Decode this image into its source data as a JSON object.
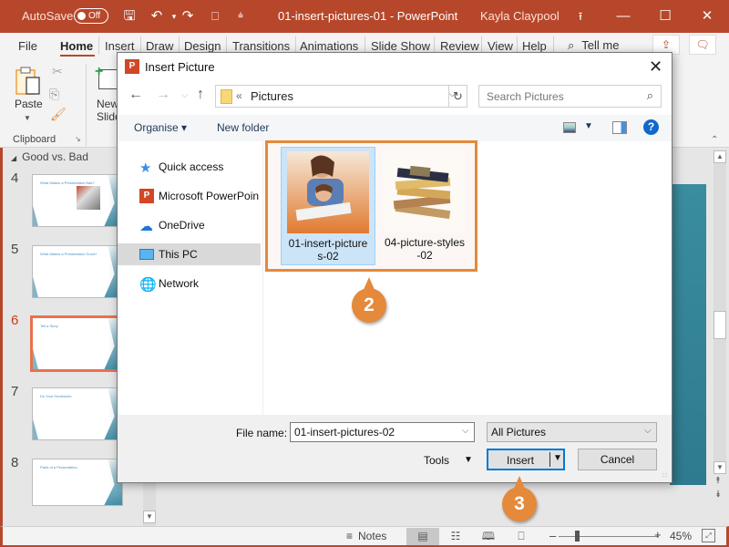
{
  "titlebar": {
    "autosave_label": "AutoSave",
    "autosave_state": "Off",
    "document_title": "01-insert-pictures-01  -  PowerPoint",
    "user_name": "Kayla Claypool",
    "icons": [
      "save-icon",
      "undo-icon",
      "redo-icon",
      "start-presentation-icon",
      "customize-toolbar-icon"
    ]
  },
  "ribbon": {
    "tabs": [
      {
        "label": "File"
      },
      {
        "label": "Home",
        "active": true
      },
      {
        "label": "Insert"
      },
      {
        "label": "Draw"
      },
      {
        "label": "Design"
      },
      {
        "label": "Transitions"
      },
      {
        "label": "Animations"
      },
      {
        "label": "Slide Show"
      },
      {
        "label": "Review"
      },
      {
        "label": "View"
      },
      {
        "label": "Help"
      }
    ],
    "tell_me": "Tell me",
    "clipboard": {
      "paste_label": "Paste",
      "group_label": "Clipboard"
    },
    "new_slide_label_1": "New",
    "new_slide_label_2": "Slide"
  },
  "slide_pane": {
    "section_name": "Good vs. Bad",
    "slides": [
      {
        "number": "4",
        "title": "What Makes a Presentation Bad?"
      },
      {
        "number": "5",
        "title": "What Makes a Presentation Good?"
      },
      {
        "number": "6",
        "title": "Tell a Story",
        "active": true
      },
      {
        "number": "7",
        "title": "Do Your Homework"
      },
      {
        "number": "8",
        "title": "Parts of a Presentation"
      }
    ]
  },
  "dialog": {
    "title": "Insert Picture",
    "address_prefix": "«",
    "address_location": "Pictures",
    "search_placeholder": "Search Pictures",
    "toolbar": {
      "organise_label": "Organise ▾",
      "new_folder_label": "New folder"
    },
    "nav_items": [
      {
        "label": "Quick access",
        "icon": "quick-access-star-icon"
      },
      {
        "label": "Microsoft PowerPoin",
        "icon": "powerpoint-icon"
      },
      {
        "label": "OneDrive",
        "icon": "onedrive-cloud-icon"
      },
      {
        "label": "This PC",
        "icon": "this-pc-monitor-icon",
        "selected": true
      },
      {
        "label": "Network",
        "icon": "network-icon"
      }
    ],
    "files": [
      {
        "name_line1": "01-insert-picture",
        "name_line2": "s-02",
        "selected": true,
        "thumb": "mother-daughter-reading"
      },
      {
        "name_line1": "04-picture-styles",
        "name_line2": "-02",
        "selected": false,
        "thumb": "stack-of-books"
      }
    ],
    "file_name_label": "File name:",
    "file_name_value": "01-insert-pictures-02",
    "file_type_filter": "All Pictures",
    "tools_label": "Tools",
    "insert_label": "Insert",
    "cancel_label": "Cancel"
  },
  "callouts": {
    "step2": "2",
    "step3": "3"
  },
  "statusbar": {
    "notes_label": "Notes",
    "zoom_level": "45%",
    "zoom_fraction": 0.45
  },
  "colors": {
    "brand": "#b7472a",
    "callout": "#e5893a",
    "selection": "#cce4f7",
    "accent_blue": "#0078d7"
  }
}
